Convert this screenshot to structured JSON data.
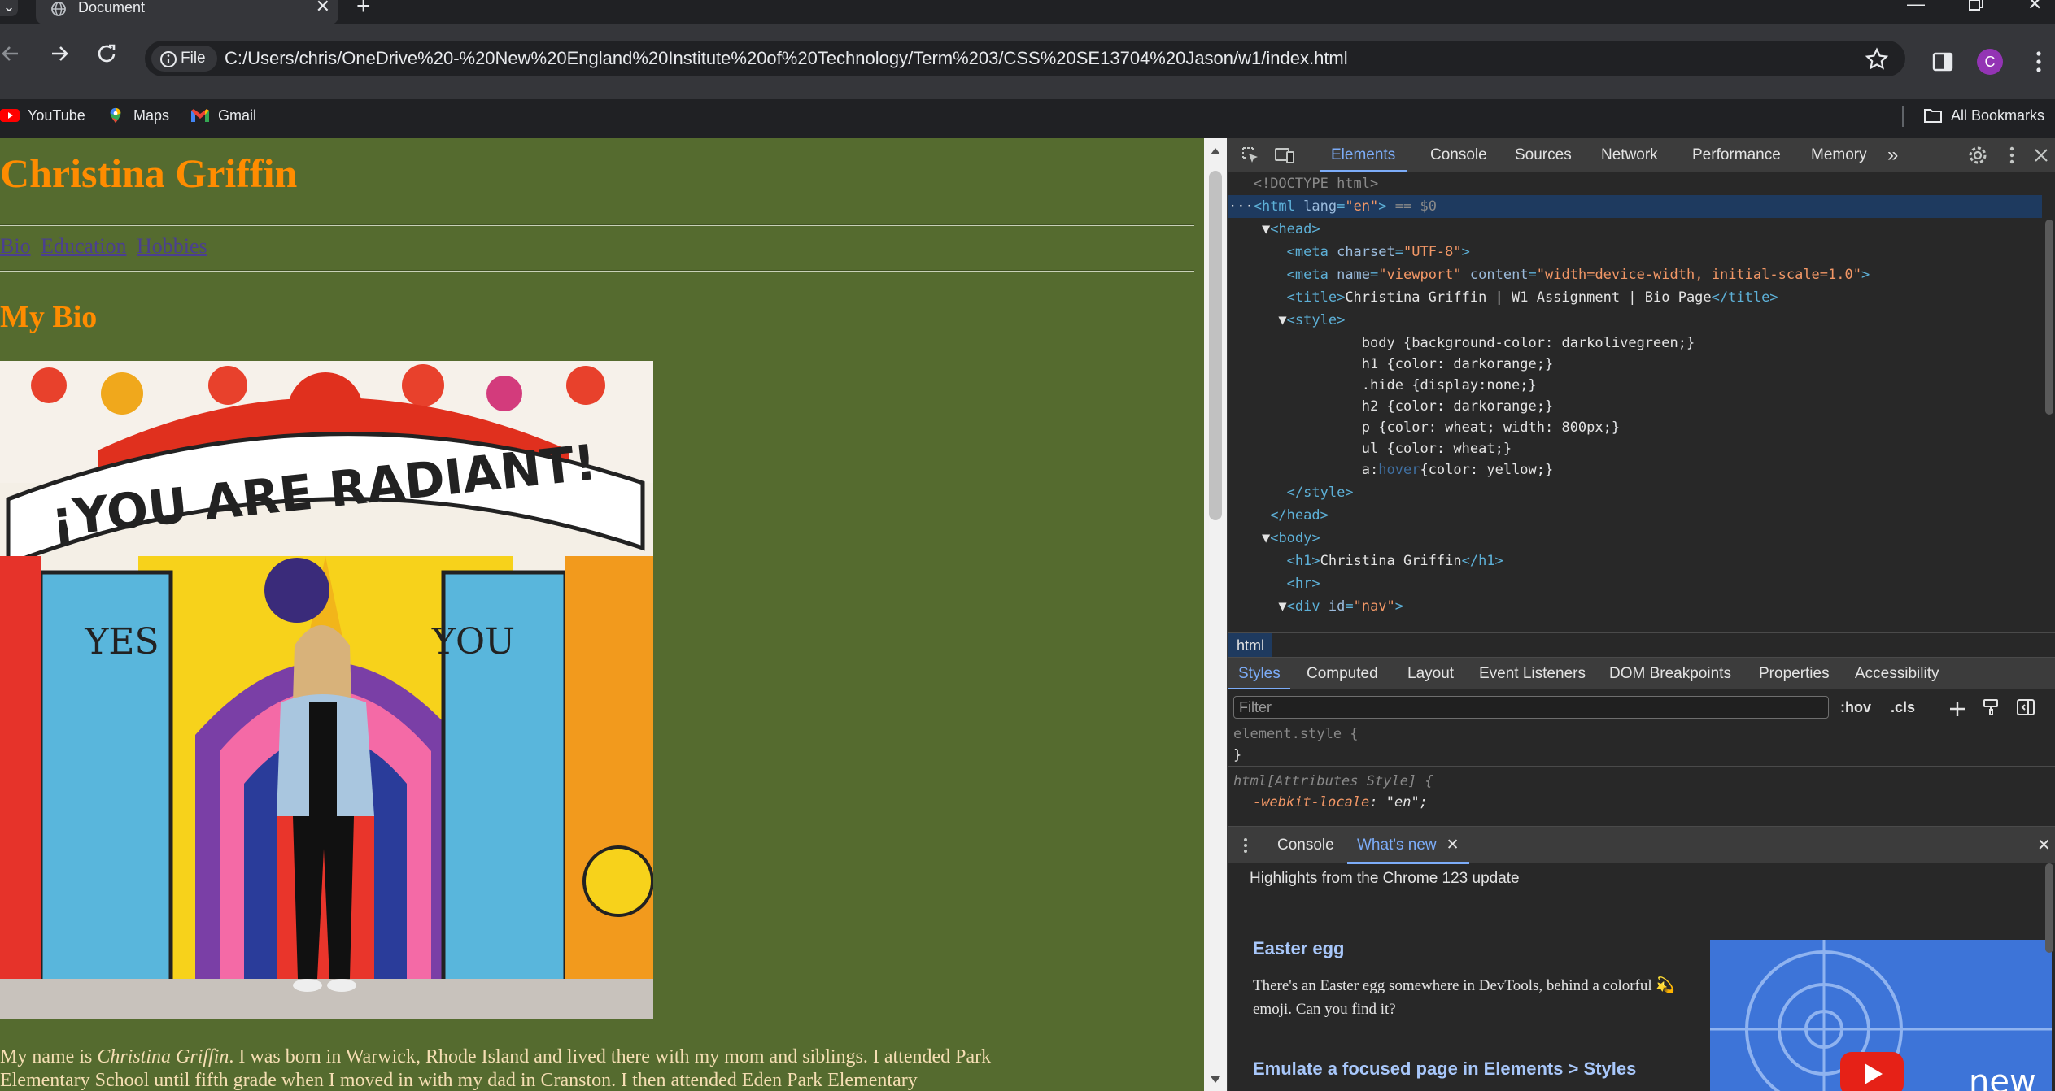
{
  "browser": {
    "tab_title": "Document",
    "file_chip": "File",
    "url": "C:/Users/chris/OneDrive%20-%20New%20England%20Institute%20of%20Technology/Term%203/CSS%20SE13704%20Jason/w1/index.html",
    "avatar_letter": "C",
    "bookmarks": [
      {
        "label": "YouTube",
        "icon": "youtube-icon"
      },
      {
        "label": "Maps",
        "icon": "maps-icon"
      },
      {
        "label": "Gmail",
        "icon": "gmail-icon"
      }
    ],
    "all_bookmarks": "All Bookmarks"
  },
  "page": {
    "h1": "Christina Griffin",
    "nav": [
      "Bio",
      "Education",
      "Hobbies"
    ],
    "h2": "My Bio",
    "mural_banner": "¡YOU ARE RADIANT!",
    "mural_left": "YES",
    "mural_right": "YOU",
    "p_prefix": "My name is ",
    "p_name": "Christina Griffin",
    "p_rest": ". I was born in Warwick, Rhode Island and lived there with my mom and siblings. I attended Park Elementary School until fifth grade when I moved in with my dad in Cranston. I then attended Eden Park Elementary",
    "colors": {
      "background": "#556b2f",
      "heading": "#ff8c00",
      "text": "#f5deb3",
      "link": "#4b3f90"
    }
  },
  "devtools": {
    "tabs": [
      "Elements",
      "Console",
      "Sources",
      "Network",
      "Performance",
      "Memory"
    ],
    "more": "»",
    "dom": {
      "doctype": "<!DOCTYPE html>",
      "html_sel_suffix": " == $0",
      "lines": {
        "l_head": "<head>",
        "l_meta1_tag": "<meta ",
        "l_meta1_attr": "charset",
        "l_meta1_val": "\"UTF-8\"",
        "l_meta2_attr1": "name",
        "l_meta2_val1": "\"viewport\"",
        "l_meta2_attr2": "content",
        "l_meta2_val2": "\"width=device-width, initial-scale=1.0\"",
        "title_text": "Christina Griffin | W1 Assignment | Bio Page",
        "css": [
          {
            "sel": "body",
            "prop": "background-color",
            "val": "darkolivegreen"
          },
          {
            "sel": "h1",
            "prop": "color",
            "val": "darkorange"
          },
          {
            "sel": ".hide",
            "prop": "display",
            "val": "none"
          },
          {
            "sel": "h2",
            "prop": "color",
            "val": "darkorange"
          },
          {
            "sel": "p",
            "prop": "color",
            "val": "wheat; width: 800px"
          },
          {
            "sel": "ul",
            "prop": "color",
            "val": "wheat"
          },
          {
            "sel": "a:hover",
            "prop": "color",
            "val": "yellow"
          }
        ],
        "h1_text": "Christina Griffin",
        "div_id": "\"nav\""
      }
    },
    "breadcrumb": "html",
    "style_tabs": [
      "Styles",
      "Computed",
      "Layout",
      "Event Listeners",
      "DOM Breakpoints",
      "Properties",
      "Accessibility"
    ],
    "filter_placeholder": "Filter",
    "hov": ":hov",
    "cls": ".cls",
    "rules": {
      "element_style": "element.style {",
      "close": "}",
      "attr_style": "html[Attributes Style] {",
      "locale_prop": "-webkit-locale",
      "locale_val": "\"en\";"
    },
    "drawer": {
      "tabs": [
        "Console",
        "What's new"
      ],
      "highlights": "Highlights from the Chrome 123 update",
      "easter_head": "Easter egg",
      "easter_text": "There's an Easter egg somewhere in DevTools, behind a colorful 💫 emoji. Can you find it?",
      "emulate_head": "Emulate a focused page in Elements > Styles",
      "video_label": "new"
    }
  }
}
